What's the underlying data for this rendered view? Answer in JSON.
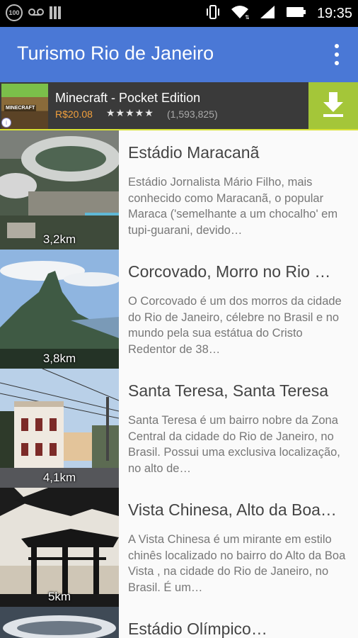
{
  "status_bar": {
    "badge": "100",
    "time": "19:35",
    "icons": [
      "vibrate-icon",
      "wifi-icon",
      "signal-icon",
      "battery-icon"
    ]
  },
  "app_bar": {
    "title": "Turismo Rio de Janeiro",
    "menu_icon": "overflow-menu-icon"
  },
  "ad": {
    "thumb_label": "MINECRAFT",
    "title": "Minecraft - Pocket Edition",
    "price": "R$20.08",
    "stars": "★★★★★",
    "rating": 4.5,
    "reviews": "(1,593,825)",
    "action_icon": "download-icon",
    "accent": "#a4c639"
  },
  "places": [
    {
      "title": "Estádio Maracanã",
      "description": "Estádio Jornalista Mário Filho, mais conhecido como Maracanã, o popular Maraca ('semelhante a um chocalho' em tupi-guarani, devido…",
      "distance": "3,2km"
    },
    {
      "title": "Corcovado, Morro no Rio …",
      "description": "O Corcovado é um dos morros da cidade do Rio de Janeiro, célebre no Brasil e no mundo pela sua estátua do Cristo Redentor de 38…",
      "distance": "3,8km"
    },
    {
      "title": "Santa Teresa, Santa Teresa",
      "description": "Santa Teresa é um bairro nobre da Zona Central da cidade do Rio de Janeiro, no Brasil. Possui uma exclusiva localização, no alto de…",
      "distance": "4,1km"
    },
    {
      "title": "Vista Chinesa, Alto da Boa…",
      "description": "A Vista Chinesa é um mirante em estilo chinês localizado no bairro do Alto da Boa Vista , na cidade do Rio de Janeiro, no Brasil. É um…",
      "distance": "5km"
    },
    {
      "title": "Estádio Olímpico…",
      "description": "",
      "distance": ""
    }
  ],
  "colors": {
    "app_bar": "#4a78d6",
    "status_bar": "#000000",
    "price": "#f2a03d"
  }
}
